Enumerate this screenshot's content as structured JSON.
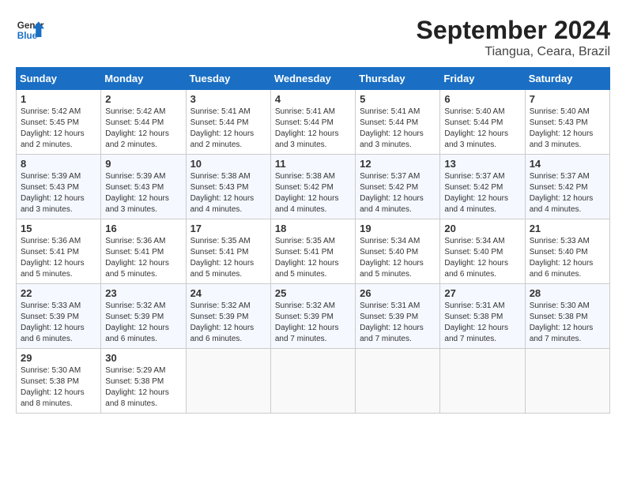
{
  "header": {
    "logo_line1": "General",
    "logo_line2": "Blue",
    "month": "September 2024",
    "location": "Tiangua, Ceara, Brazil"
  },
  "weekdays": [
    "Sunday",
    "Monday",
    "Tuesday",
    "Wednesday",
    "Thursday",
    "Friday",
    "Saturday"
  ],
  "weeks": [
    [
      {
        "day": "1",
        "sunrise": "5:42 AM",
        "sunset": "5:45 PM",
        "daylight": "12 hours and 2 minutes."
      },
      {
        "day": "2",
        "sunrise": "5:42 AM",
        "sunset": "5:44 PM",
        "daylight": "12 hours and 2 minutes."
      },
      {
        "day": "3",
        "sunrise": "5:41 AM",
        "sunset": "5:44 PM",
        "daylight": "12 hours and 2 minutes."
      },
      {
        "day": "4",
        "sunrise": "5:41 AM",
        "sunset": "5:44 PM",
        "daylight": "12 hours and 3 minutes."
      },
      {
        "day": "5",
        "sunrise": "5:41 AM",
        "sunset": "5:44 PM",
        "daylight": "12 hours and 3 minutes."
      },
      {
        "day": "6",
        "sunrise": "5:40 AM",
        "sunset": "5:44 PM",
        "daylight": "12 hours and 3 minutes."
      },
      {
        "day": "7",
        "sunrise": "5:40 AM",
        "sunset": "5:43 PM",
        "daylight": "12 hours and 3 minutes."
      }
    ],
    [
      {
        "day": "8",
        "sunrise": "5:39 AM",
        "sunset": "5:43 PM",
        "daylight": "12 hours and 3 minutes."
      },
      {
        "day": "9",
        "sunrise": "5:39 AM",
        "sunset": "5:43 PM",
        "daylight": "12 hours and 3 minutes."
      },
      {
        "day": "10",
        "sunrise": "5:38 AM",
        "sunset": "5:43 PM",
        "daylight": "12 hours and 4 minutes."
      },
      {
        "day": "11",
        "sunrise": "5:38 AM",
        "sunset": "5:42 PM",
        "daylight": "12 hours and 4 minutes."
      },
      {
        "day": "12",
        "sunrise": "5:37 AM",
        "sunset": "5:42 PM",
        "daylight": "12 hours and 4 minutes."
      },
      {
        "day": "13",
        "sunrise": "5:37 AM",
        "sunset": "5:42 PM",
        "daylight": "12 hours and 4 minutes."
      },
      {
        "day": "14",
        "sunrise": "5:37 AM",
        "sunset": "5:42 PM",
        "daylight": "12 hours and 4 minutes."
      }
    ],
    [
      {
        "day": "15",
        "sunrise": "5:36 AM",
        "sunset": "5:41 PM",
        "daylight": "12 hours and 5 minutes."
      },
      {
        "day": "16",
        "sunrise": "5:36 AM",
        "sunset": "5:41 PM",
        "daylight": "12 hours and 5 minutes."
      },
      {
        "day": "17",
        "sunrise": "5:35 AM",
        "sunset": "5:41 PM",
        "daylight": "12 hours and 5 minutes."
      },
      {
        "day": "18",
        "sunrise": "5:35 AM",
        "sunset": "5:41 PM",
        "daylight": "12 hours and 5 minutes."
      },
      {
        "day": "19",
        "sunrise": "5:34 AM",
        "sunset": "5:40 PM",
        "daylight": "12 hours and 5 minutes."
      },
      {
        "day": "20",
        "sunrise": "5:34 AM",
        "sunset": "5:40 PM",
        "daylight": "12 hours and 6 minutes."
      },
      {
        "day": "21",
        "sunrise": "5:33 AM",
        "sunset": "5:40 PM",
        "daylight": "12 hours and 6 minutes."
      }
    ],
    [
      {
        "day": "22",
        "sunrise": "5:33 AM",
        "sunset": "5:39 PM",
        "daylight": "12 hours and 6 minutes."
      },
      {
        "day": "23",
        "sunrise": "5:32 AM",
        "sunset": "5:39 PM",
        "daylight": "12 hours and 6 minutes."
      },
      {
        "day": "24",
        "sunrise": "5:32 AM",
        "sunset": "5:39 PM",
        "daylight": "12 hours and 6 minutes."
      },
      {
        "day": "25",
        "sunrise": "5:32 AM",
        "sunset": "5:39 PM",
        "daylight": "12 hours and 7 minutes."
      },
      {
        "day": "26",
        "sunrise": "5:31 AM",
        "sunset": "5:39 PM",
        "daylight": "12 hours and 7 minutes."
      },
      {
        "day": "27",
        "sunrise": "5:31 AM",
        "sunset": "5:38 PM",
        "daylight": "12 hours and 7 minutes."
      },
      {
        "day": "28",
        "sunrise": "5:30 AM",
        "sunset": "5:38 PM",
        "daylight": "12 hours and 7 minutes."
      }
    ],
    [
      {
        "day": "29",
        "sunrise": "5:30 AM",
        "sunset": "5:38 PM",
        "daylight": "12 hours and 8 minutes."
      },
      {
        "day": "30",
        "sunrise": "5:29 AM",
        "sunset": "5:38 PM",
        "daylight": "12 hours and 8 minutes."
      },
      {
        "day": "",
        "sunrise": "",
        "sunset": "",
        "daylight": ""
      },
      {
        "day": "",
        "sunrise": "",
        "sunset": "",
        "daylight": ""
      },
      {
        "day": "",
        "sunrise": "",
        "sunset": "",
        "daylight": ""
      },
      {
        "day": "",
        "sunrise": "",
        "sunset": "",
        "daylight": ""
      },
      {
        "day": "",
        "sunrise": "",
        "sunset": "",
        "daylight": ""
      }
    ]
  ]
}
